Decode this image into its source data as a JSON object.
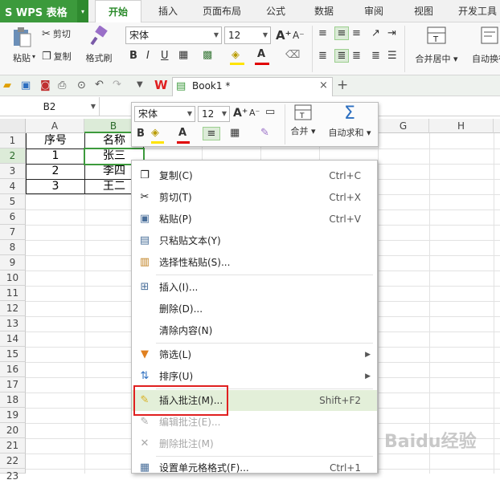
{
  "app": {
    "logo": "S WPS 表格",
    "logo_arrow": "▾"
  },
  "menu": {
    "tabs": [
      "开始",
      "插入",
      "页面布局",
      "公式",
      "数据",
      "审阅",
      "视图",
      "开发工具"
    ]
  },
  "ribbon": {
    "paste": "粘贴",
    "cut": "剪切",
    "copy": "复制",
    "format_painter": "格式刷",
    "font_name": "宋体",
    "font_size": "12",
    "merge_center": "合并居中",
    "auto_wrap": "自动换行"
  },
  "doc": {
    "tab_title": "Book1 *",
    "close": "×",
    "add": "+"
  },
  "formula": {
    "name_box": "B2"
  },
  "grid": {
    "columns": [
      "A",
      "B",
      "C",
      "D",
      "E",
      "F",
      "G",
      "H"
    ],
    "rows": [
      "1",
      "2",
      "3",
      "4",
      "5",
      "6",
      "7",
      "8",
      "9",
      "10",
      "11",
      "12",
      "13",
      "14",
      "15",
      "16",
      "17",
      "18",
      "19",
      "20",
      "21",
      "22",
      "23"
    ],
    "cells": {
      "a1": "序号",
      "b1": "名称",
      "a2": "1",
      "b2": "张三",
      "a3": "2",
      "b3": "李四",
      "a4": "3",
      "b4": "王二"
    }
  },
  "mini_toolbar": {
    "font_name": "宋体",
    "font_size": "12",
    "merge": "合并",
    "autosum": "自动求和"
  },
  "context_menu": {
    "copy": {
      "label": "复制(C)",
      "shortcut": "Ctrl+C"
    },
    "cut": {
      "label": "剪切(T)",
      "shortcut": "Ctrl+X"
    },
    "paste": {
      "label": "粘贴(P)",
      "shortcut": "Ctrl+V"
    },
    "paste_text": {
      "label": "只粘贴文本(Y)"
    },
    "paste_special": {
      "label": "选择性粘贴(S)..."
    },
    "insert": {
      "label": "插入(I)..."
    },
    "delete": {
      "label": "删除(D)..."
    },
    "clear": {
      "label": "清除内容(N)"
    },
    "filter": {
      "label": "筛选(L)"
    },
    "sort": {
      "label": "排序(U)"
    },
    "insert_comment": {
      "label": "插入批注(M)...",
      "shortcut": "Shift+F2"
    },
    "edit_comment": {
      "label": "编辑批注(E)..."
    },
    "delete_comment": {
      "label": "删除批注(M)"
    },
    "format_cells": {
      "label": "设置单元格格式(F)...",
      "shortcut": "Ctrl+1"
    }
  },
  "watermark": {
    "text": "Baidu经验"
  },
  "colors": {
    "brand_green": "#3c9a3c",
    "highlight": "#e3efd9",
    "red_box": "#e02020"
  }
}
